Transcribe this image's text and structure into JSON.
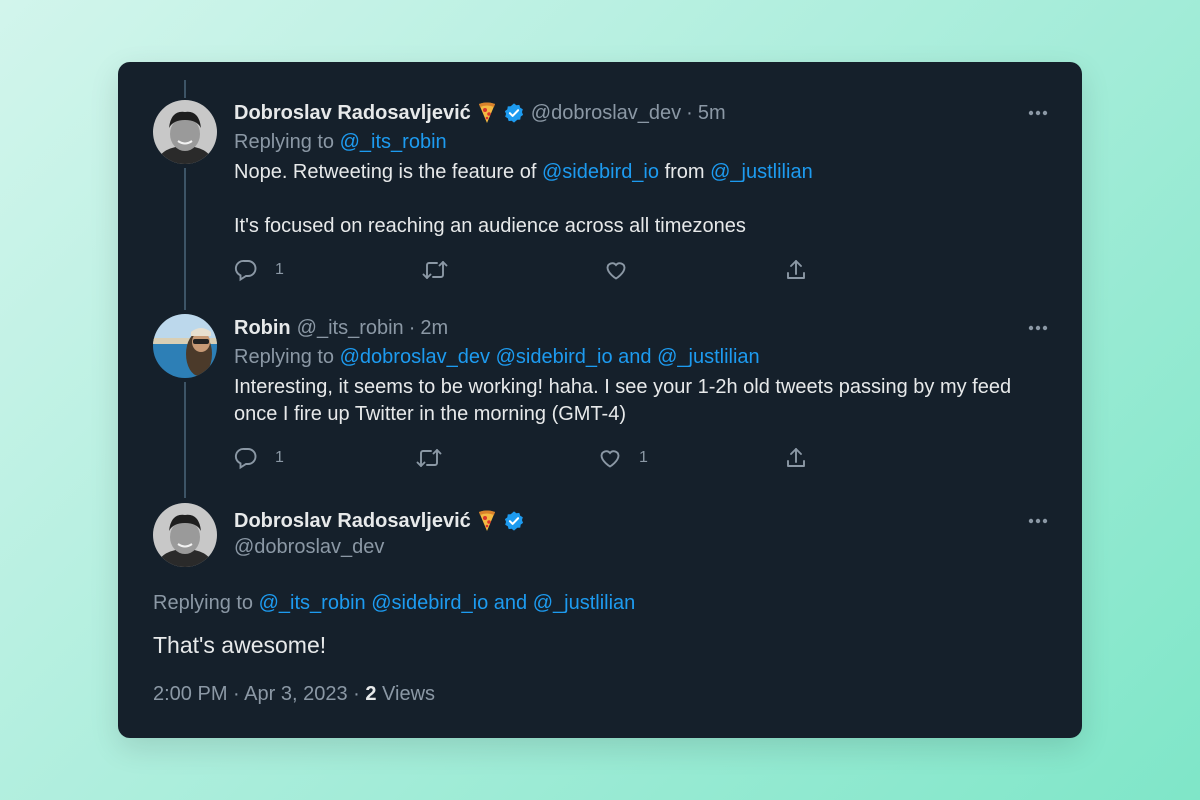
{
  "tweets": [
    {
      "name": "Dobroslav Radosavljević",
      "handle": "@dobroslav_dev",
      "time": "5m",
      "replying_prefix": "Replying to",
      "replying_to": "@_its_robin",
      "text_parts": [
        "Nope. Retweeting is the feature of",
        "@sidebird_io",
        "from",
        "@_justlilian"
      ],
      "text_line2": "It's focused on reaching an audience across all timezones",
      "reply_count": "1",
      "like_count": ""
    },
    {
      "name": "Robin",
      "handle": "@_its_robin",
      "time": "2m",
      "replying_prefix": "Replying to",
      "replying_to": "@dobroslav_dev @sidebird_io and @_justlilian",
      "text_line1": "Interesting, it seems to be working! haha. I see your 1-2h old tweets passing by my feed",
      "text_line2": "once I fire up Twitter in the morning (GMT-4)",
      "reply_count": "1",
      "like_count": "1"
    }
  ],
  "main_tweet": {
    "name": "Dobroslav Radosavljević",
    "handle": "@dobroslav_dev",
    "replying_prefix": "Replying to",
    "replying_to": "@_its_robin @sidebird_io and @_justlilian",
    "text": "That's awesome!",
    "timestamp": "2:00 PM · Apr 3, 2023 ·",
    "views_count": "2",
    "views_label": "Views"
  },
  "colors": {
    "card_bg": "#15202b",
    "text": "#e7e9ea",
    "muted": "#8b98a5",
    "accent": "#1d9bf0"
  },
  "icons": [
    "reply-icon",
    "retweet-icon",
    "like-icon",
    "share-icon",
    "more-icon",
    "verified-badge-icon",
    "pizza-emoji-icon"
  ]
}
